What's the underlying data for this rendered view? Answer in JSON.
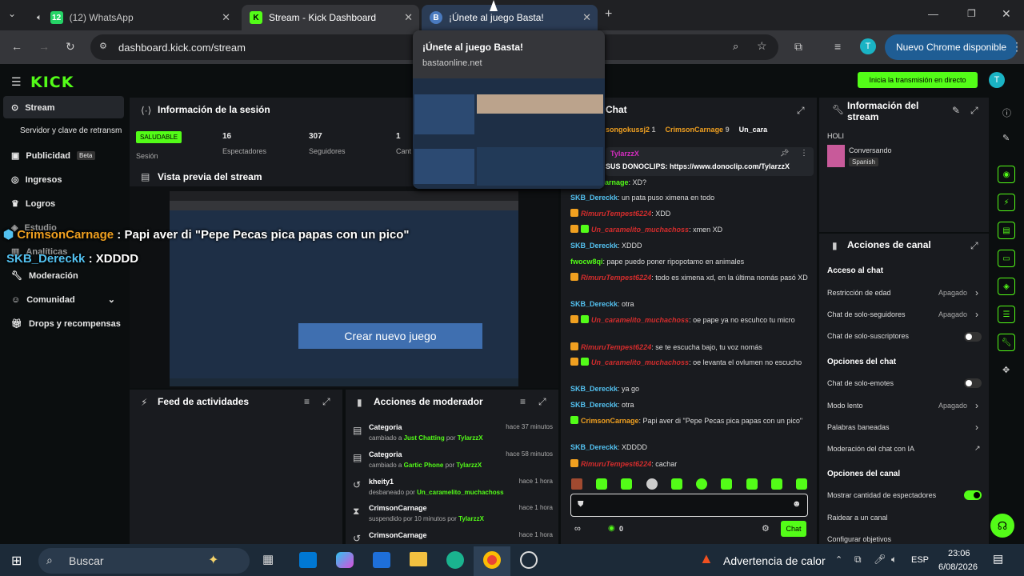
{
  "tabs": [
    {
      "title": "(12) WhatsApp"
    },
    {
      "title": "Stream - Kick Dashboard"
    },
    {
      "title": "¡Únete al juego Basta!"
    }
  ],
  "url": "dashboard.kick.com/stream",
  "new_chrome": "Nuevo Chrome disponible",
  "hovercard": {
    "title": "¡Únete al juego Basta!",
    "domain": "bastaonline.net"
  },
  "logo": "KICK",
  "start_stream": "Inicia la transmisión en directo",
  "sidebar": {
    "items": [
      {
        "label": "Stream"
      },
      {
        "label": "Servidor y clave de retransm"
      },
      {
        "label": "Publicidad"
      },
      {
        "label": "Ingresos"
      },
      {
        "label": "Logros"
      },
      {
        "label": "Estudio"
      },
      {
        "label": "Analíticas"
      },
      {
        "label": "Moderación"
      },
      {
        "label": "Comunidad"
      },
      {
        "label": "Drops y recompensas"
      }
    ],
    "beta": "Beta"
  },
  "session": {
    "title": "Información de la sesión",
    "status": "SALUDABLE",
    "status_label": "Sesión",
    "viewers": "16",
    "viewers_label": "Espectadores",
    "followers": "307",
    "followers_label": "Seguidores",
    "subs": "1",
    "subs_label": "Cant"
  },
  "preview": {
    "title": "Vista previa del stream",
    "create_button": "Crear nuevo juego"
  },
  "overlay": [
    {
      "user": "CrimsonCarnage",
      "text": " : Papi aver di \"Pepe Pecas pica papas con un pico\""
    },
    {
      "user": "SKB_Dereckk",
      "text": " : XDDDD"
    }
  ],
  "activity": {
    "title": "Feed de actividades"
  },
  "modactions": {
    "title": "Acciones de moderador",
    "items": [
      {
        "title": "Categoria",
        "prefix": "cambiado a ",
        "target": "Just Chatting",
        "by": "TylarzzX",
        "time": "hace 37 minutos"
      },
      {
        "title": "Categoria",
        "prefix": "cambiado a ",
        "target": "Gartic Phone",
        "by": "TylarzzX",
        "time": "hace 58 minutos"
      },
      {
        "title": "kheity1",
        "prefix": "desbaneado por ",
        "target": "Un_caramelito_muchachoss",
        "by": "",
        "time": "hace 1 hora"
      },
      {
        "title": "CrimsonCarnage",
        "prefix": "suspendido por 10 minutos por ",
        "target": "TylarzzX",
        "by": "",
        "time": "hace 1 hora"
      },
      {
        "title": "CrimsonCarnage",
        "prefix": "",
        "target": "",
        "by": "",
        "time": "hace 1 hora"
      }
    ]
  },
  "chat": {
    "title": "Chat",
    "top": [
      "songokussj2",
      "CrimsonCarnage",
      "Un_cara"
    ],
    "top_counts": [
      "1",
      "9",
      ""
    ],
    "pinned_user": "TylarzzX",
    "pinned_text": "SUS DONOCLIPS: https://www.donoclip.com/TylarzzX",
    "messages": [
      {
        "u": "CrimsonCarnage",
        "t": ": XD?"
      },
      {
        "u": "SKB_Dereckk",
        "t": ": un pata puso ximena en todo"
      },
      {
        "u": "RimuruTempest6224",
        "t": ": XDD"
      },
      {
        "u": "Un_caramelito_muchachoss",
        "t": ": xmen XD"
      },
      {
        "u": "SKB_Dereckk",
        "t": ": XDDD"
      },
      {
        "u": "fwocw8qi",
        "t": ": pape puedo poner ripopotamo en animales"
      },
      {
        "u": "RimuruTempest6224",
        "t": ": todo es ximena xd, en la última nomás pasó XD"
      },
      {
        "u": "SKB_Dereckk",
        "t": ": otra"
      },
      {
        "u": "Un_caramelito_muchachoss",
        "t": ": oe pape ya no escuhco tu micro"
      },
      {
        "u": "RimuruTempest6224",
        "t": ": se te escucha bajo, tu voz nomás"
      },
      {
        "u": "Un_caramelito_muchachoss",
        "t": ": oe levanta el ovlumen no escucho"
      },
      {
        "u": "SKB_Dereckk",
        "t": ": ya go"
      },
      {
        "u": "SKB_Dereckk",
        "t": ": otra"
      },
      {
        "u": "CrimsonCarnage",
        "t": ": Papi aver di \"Pepe Pecas pica papas con un pico\""
      },
      {
        "u": "SKB_Dereckk",
        "t": ": XDDDD"
      },
      {
        "u": "RimuruTempest6224",
        "t": ": cachar"
      }
    ],
    "input_placeholder": "",
    "count": "0",
    "send": "Chat"
  },
  "streaminfo": {
    "title": "Información del stream",
    "stream_title": "HOLI",
    "category": "Conversando",
    "lang": "Spanish"
  },
  "channel": {
    "title": "Acciones de canal",
    "access": "Acceso al chat",
    "age": "Restricción de edad",
    "age_v": "Apagado",
    "followers": "Chat de solo-seguidores",
    "followers_v": "Apagado",
    "subs": "Chat de solo-suscriptores",
    "chatopts": "Opciones del chat",
    "emotes": "Chat de solo-emotes",
    "slow": "Modo lento",
    "slow_v": "Apagado",
    "banned": "Palabras baneadas",
    "ai": "Moderación del chat con IA",
    "chanopts": "Opciones del canal",
    "showcount": "Mostrar cantidad de espectadores",
    "raid": "Raidear a un canal",
    "goals": "Configurar objetivos"
  },
  "taskbar": {
    "search": "Buscar",
    "warning": "Advertencia de calor",
    "lang": "ESP",
    "time": "23:06",
    "date": "6/08/2026"
  },
  "colors": {
    "kick_green": "#53fc18",
    "panel": "#191b1f"
  }
}
